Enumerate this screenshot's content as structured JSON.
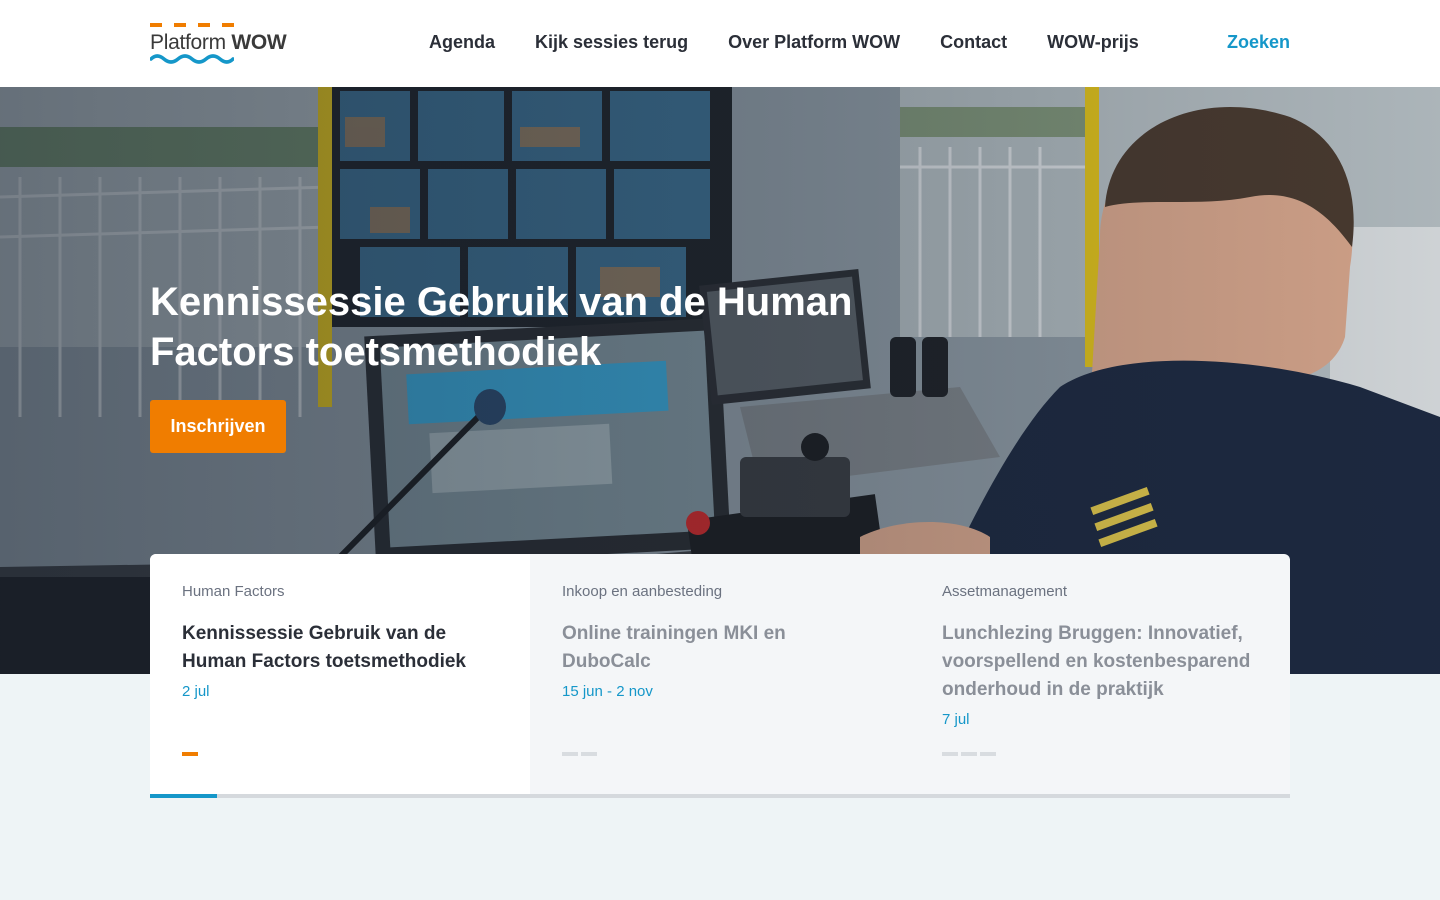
{
  "header": {
    "logo": {
      "brand": "Platform",
      "brand_bold": "WOW"
    },
    "nav": [
      {
        "label": "Agenda"
      },
      {
        "label": "Kijk sessies terug"
      },
      {
        "label": "Over Platform WOW"
      },
      {
        "label": "Contact"
      },
      {
        "label": "WOW-prijs"
      }
    ],
    "search_label": "Zoeken"
  },
  "hero": {
    "title": "Kennissessie Gebruik van de Human Factors toetsmethodiek",
    "cta_label": "Inschrijven"
  },
  "cards": [
    {
      "category": "Human Factors",
      "title": "Kennissessie Gebruik van de Human Factors toetsmethodiek",
      "date": "2 jul",
      "dots": 1,
      "active": true
    },
    {
      "category": "Inkoop en aanbesteding",
      "title": "Online trainingen MKI en DuboCalc",
      "date": "15 jun - 2 nov",
      "dots": 2,
      "active": false
    },
    {
      "category": "Assetmanagement",
      "title": "Lunchlezing Bruggen: Innovatief, voorspellend en kostenbesparend onderhoud in de praktijk",
      "date": "7 jul",
      "dots": 3,
      "active": false
    }
  ],
  "progress": {
    "fraction": 0.059
  },
  "colors": {
    "accent_orange": "#f07d00",
    "accent_blue": "#1597c9",
    "text_dark": "#2b2f38",
    "page_bg": "#eef4f6"
  }
}
